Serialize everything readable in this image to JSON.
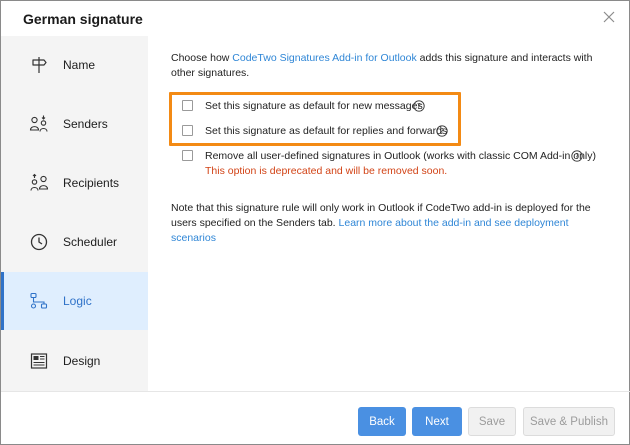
{
  "dialog": {
    "title": "German signature"
  },
  "sidebar": {
    "items": [
      {
        "label": "Name",
        "icon": "signpost-icon"
      },
      {
        "label": "Senders",
        "icon": "senders-icon"
      },
      {
        "label": "Recipients",
        "icon": "recipients-icon"
      },
      {
        "label": "Scheduler",
        "icon": "clock-icon"
      },
      {
        "label": "Logic",
        "icon": "logic-flow-icon",
        "active": true
      },
      {
        "label": "Design",
        "icon": "design-layout-icon"
      }
    ]
  },
  "main": {
    "intro_prefix": "Choose how ",
    "intro_link": "CodeTwo Signatures Add-in for Outlook",
    "intro_suffix": " adds this signature and interacts with other signatures.",
    "options": [
      {
        "label": "Set this signature as default for new messages",
        "checked": false
      },
      {
        "label": "Set this signature as default for replies and forwards",
        "checked": false
      },
      {
        "label": "Remove all user-defined signatures in Outlook (works with classic COM Add-in only)",
        "checked": false
      }
    ],
    "deprecation_warning": "This option is deprecated and will be removed soon.",
    "note_text": "Note that this signature rule will only work in Outlook if CodeTwo add-in is deployed for the users specified on the Senders tab.",
    "note_link": "Learn more about the add-in and see deployment scenarios"
  },
  "footer": {
    "back_label": "Back",
    "next_label": "Next",
    "save_label": "Save",
    "save_publish_label": "Save & Publish"
  },
  "colors": {
    "accent": "#4a90e2",
    "link": "#2f86d6",
    "highlight_border": "#f38a14",
    "warning": "#d24316",
    "active_nav_bg": "#dfeefe"
  }
}
